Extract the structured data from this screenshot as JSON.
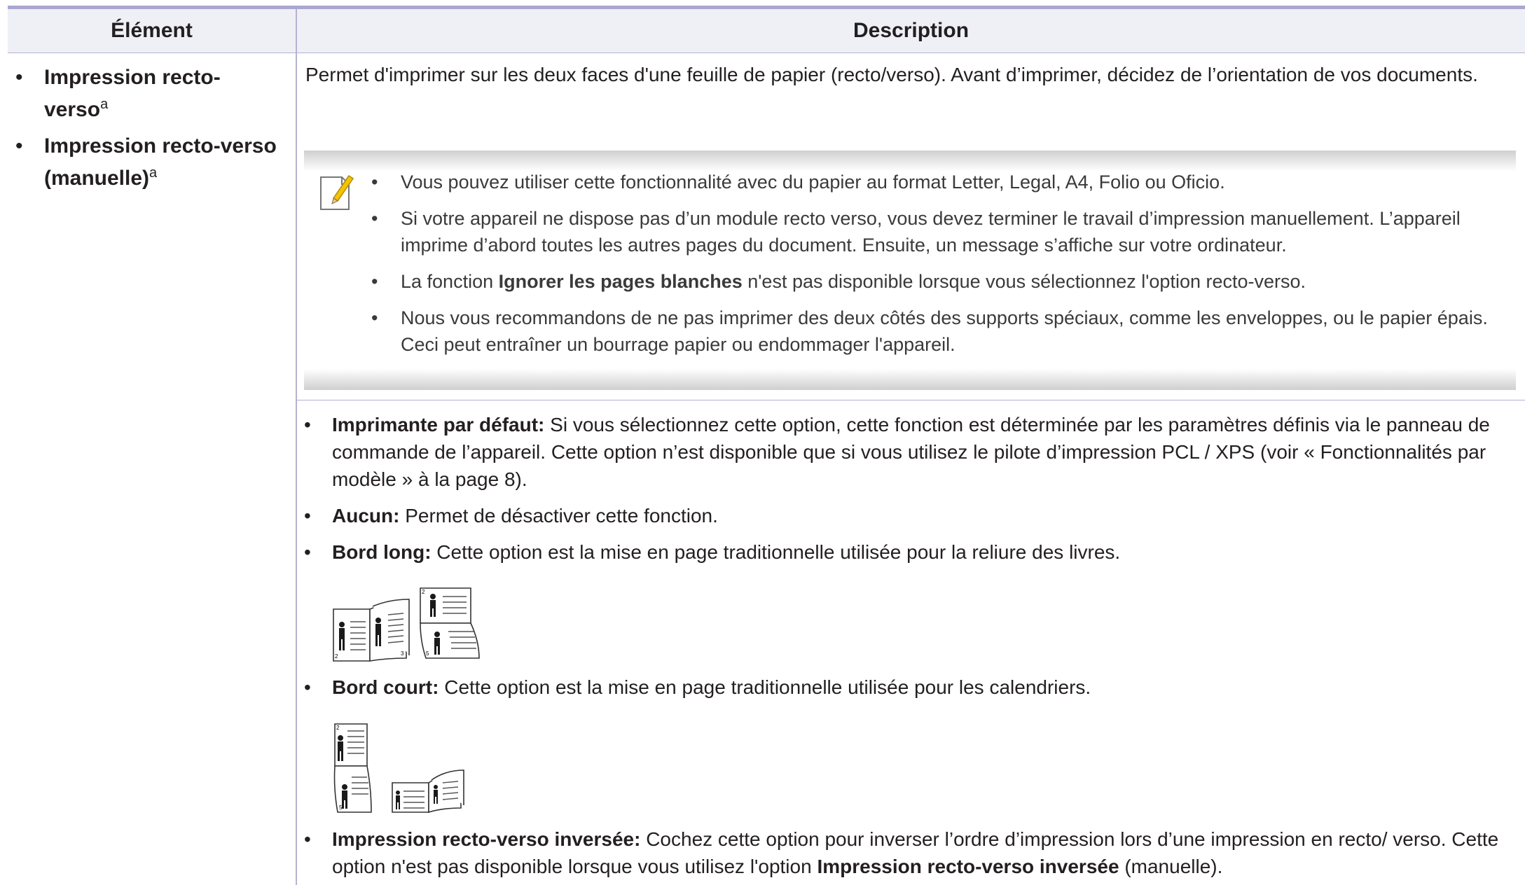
{
  "table": {
    "header": {
      "element": "Élément",
      "description": "Description"
    },
    "element_items": [
      {
        "line1": "Impression recto-",
        "line2": "verso",
        "sup": "a"
      },
      {
        "line1": "Impression recto-verso",
        "line2": "(manuelle)",
        "sup": "a"
      }
    ],
    "bullet": "•",
    "intro": "Permet d'imprimer sur les deux faces d'une feuille de papier (recto/verso). Avant d’imprimer, décidez de l’orientation de vos documents.",
    "note_icon": "note-pencil-icon",
    "notes": {
      "n1": "Vous pouvez utiliser cette fonctionnalité avec du papier au format Letter, Legal, A4, Folio ou Oficio.",
      "n2": "Si votre appareil ne dispose pas d’un module recto verso, vous devez terminer le travail d’impression manuellement. L’appareil imprime d’abord toutes les autres pages du document. Ensuite, un message s’affiche sur votre ordinateur.",
      "n3_pre": "La fonction ",
      "n3_bold": "Ignorer les pages blanches",
      "n3_post": " n'est pas disponible lorsque vous sélectionnez l'option recto-verso.",
      "n4": "Nous vous recommandons de ne pas imprimer des deux côtés des supports spéciaux, comme les enveloppes, ou le papier épais. Ceci peut entraîner un bourrage papier ou endommager l'appareil."
    },
    "options": {
      "default_label": "Imprimante par défaut:",
      "default_text": " Si vous sélectionnez cette option, cette fonction est déterminée par les paramètres définis via le panneau de commande de l’appareil. Cette option n’est disponible que si vous utilisez le pilote d’impression PCL / XPS (voir « Fonctionnalités par modèle » à la page 8).",
      "none_label": "Aucun:",
      "none_text": " Permet de désactiver cette fonction.",
      "long_label": "Bord long:",
      "long_text": " Cette option est la mise en page traditionnelle utilisée pour la reliure des livres.",
      "short_label": "Bord court:",
      "short_text": " Cette option est la mise en page traditionnelle utilisée pour les calendriers.",
      "reverse_label": "Impression recto-verso inversée:",
      "reverse_text": " Cochez cette option pour inverser l’ordre d’impression lors d’une impression en recto/ verso. Cette option n'est pas disponible lorsque vous utilisez l'option ",
      "reverse_bold": "Impression recto-verso inversée",
      "reverse_tail": " (manuelle)."
    },
    "illustration_page_numbers": {
      "a": "2",
      "b": "3",
      "c": "5"
    }
  }
}
